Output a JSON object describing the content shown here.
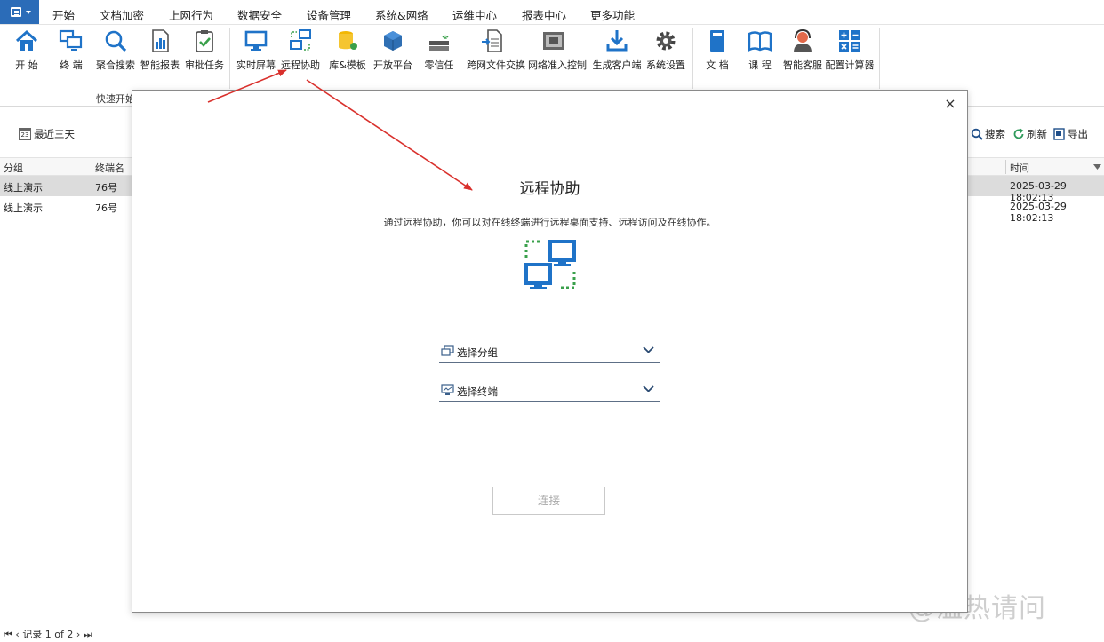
{
  "menu_tabs": [
    "开始",
    "文档加密",
    "上网行为",
    "数据安全",
    "设备管理",
    "系统&网络",
    "运维中心",
    "报表中心",
    "更多功能"
  ],
  "ribbon": {
    "buttons": [
      "开 始",
      "终 端",
      "聚合搜索",
      "智能报表",
      "审批任务",
      "实时屏幕",
      "远程协助",
      "库&模板",
      "开放平台",
      "零信任",
      "跨网文件交换",
      "网络准入控制",
      "生成客户端",
      "系统设置",
      "文 档",
      "课 程",
      "智能客服",
      "配置计算器"
    ],
    "group_caption": "快速开始"
  },
  "toolbar": {
    "date_filter": "最近三天",
    "calendar_day": "23",
    "search": "搜索",
    "refresh": "刷新",
    "export": "导出"
  },
  "grid": {
    "headers": {
      "group": "分组",
      "terminal": "终端名",
      "time": "时间"
    },
    "rows": [
      {
        "group": "线上演示",
        "terminal": "76号",
        "time": "2025-03-29 18:02:13"
      },
      {
        "group": "线上演示",
        "terminal": "76号",
        "time": "2025-03-29 18:02:13"
      }
    ]
  },
  "dialog": {
    "title": "远程协助",
    "description": "通过远程协助，你可以对在线终端进行远程桌面支持、远程访问及在线协作。",
    "select_group_placeholder": "选择分组",
    "select_terminal_placeholder": "选择终端",
    "connect_label": "连接",
    "close_glyph": "×"
  },
  "pager": {
    "text": "记录 1 of 2"
  },
  "watermark": "@温热请问",
  "colors": {
    "accent": "#2b6cb8",
    "icon_blue": "#1f73c8",
    "arrow_red": "#d9302c",
    "dotted_green": "#3aa04b"
  }
}
